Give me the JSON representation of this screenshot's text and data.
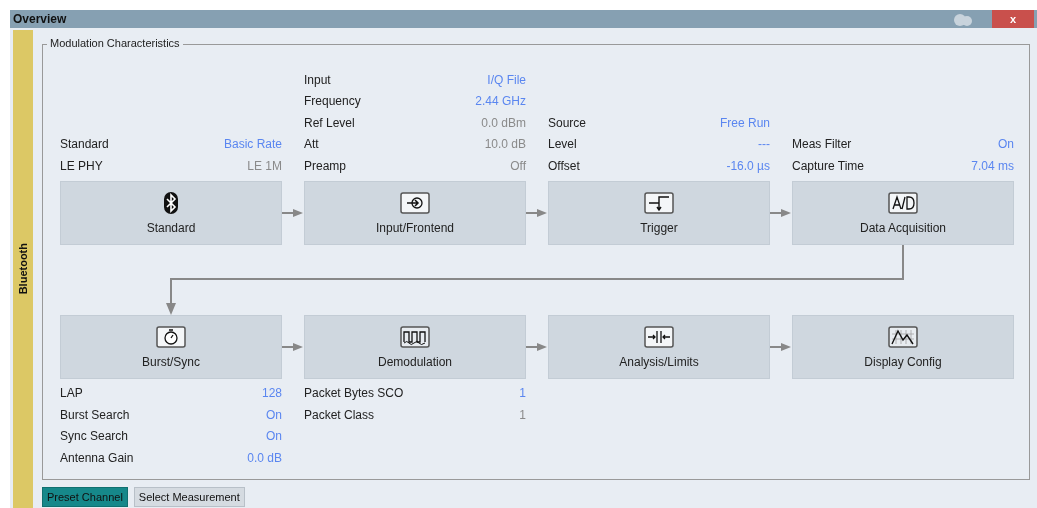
{
  "window": {
    "title": "Overview",
    "close_label": "x"
  },
  "side_tab": {
    "label": "Bluetooth"
  },
  "group": {
    "title": "Modulation Characteristics"
  },
  "top_row": [
    {
      "label": "Standard",
      "kind": "bluetooth",
      "params": [
        {
          "name": "Standard",
          "value": "Basic Rate",
          "editable": true
        },
        {
          "name": "LE PHY",
          "value": "LE 1M",
          "editable": false
        }
      ]
    },
    {
      "label": "Input/Frontend",
      "kind": "input",
      "params": [
        {
          "name": "Input",
          "value": "I/Q File",
          "editable": true
        },
        {
          "name": "Frequency",
          "value": "2.44 GHz",
          "editable": true
        },
        {
          "name": "Ref Level",
          "value": "0.0 dBm",
          "editable": false
        },
        {
          "name": "Att",
          "value": "10.0 dB",
          "editable": false
        },
        {
          "name": "Preamp",
          "value": "Off",
          "editable": false
        }
      ]
    },
    {
      "label": "Trigger",
      "kind": "trigger",
      "params": [
        {
          "name": "Source",
          "value": "Free Run",
          "editable": true
        },
        {
          "name": "Level",
          "value": "---",
          "editable": true
        },
        {
          "name": "Offset",
          "value": "-16.0 µs",
          "editable": true
        }
      ]
    },
    {
      "label": "Data Acquisition",
      "kind": "adc",
      "params": [
        {
          "name": "Meas Filter",
          "value": "On",
          "editable": true
        },
        {
          "name": "Capture Time",
          "value": "7.04 ms",
          "editable": true
        }
      ]
    }
  ],
  "bottom_row": [
    {
      "label": "Burst/Sync",
      "kind": "stopwatch",
      "params": [
        {
          "name": "LAP",
          "value": "128",
          "editable": true
        },
        {
          "name": "Burst Search",
          "value": "On",
          "editable": true
        },
        {
          "name": "Sync Search",
          "value": "On",
          "editable": true
        },
        {
          "name": "Antenna Gain",
          "value": "0.0 dB",
          "editable": true
        }
      ]
    },
    {
      "label": "Demodulation",
      "kind": "demod",
      "params": [
        {
          "name": "Packet Bytes SCO",
          "value": "1",
          "editable": true
        },
        {
          "name": "Packet Class",
          "value": "1",
          "editable": false
        }
      ]
    },
    {
      "label": "Analysis/Limits",
      "kind": "limits"
    },
    {
      "label": "Display Config",
      "kind": "display"
    }
  ],
  "buttons": [
    {
      "label": "Preset Channel",
      "selected": true
    },
    {
      "label": "Select Measurement",
      "selected": false
    }
  ]
}
